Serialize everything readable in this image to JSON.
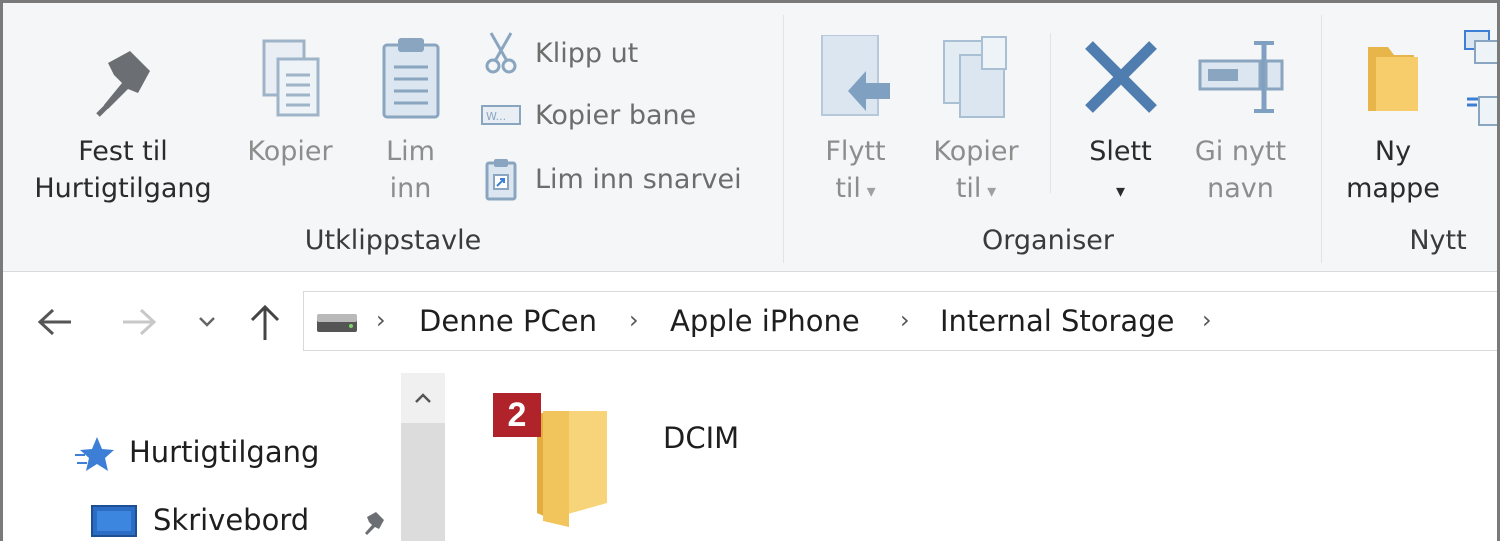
{
  "ribbon": {
    "clipboard": {
      "pin_label": "Fest til\nHurtigtilgang",
      "copy_label": "Kopier",
      "paste_label": "Lim\ninn",
      "cut_label": "Klipp ut",
      "copy_path_label": "Kopier bane",
      "paste_shortcut_label": "Lim inn snarvei",
      "group_label": "Utklippstavle"
    },
    "organize": {
      "move_label": "Flytt\ntil",
      "copyto_label": "Kopier\ntil",
      "delete_label": "Slett",
      "rename_label": "Gi nytt\nnavn",
      "group_label": "Organiser"
    },
    "new": {
      "new_folder_label": "Ny\nmappe",
      "group_label": "Nytt"
    }
  },
  "address": {
    "crumbs": [
      "Denne PCen",
      "Apple iPhone",
      "Internal Storage"
    ]
  },
  "nav": {
    "quick_access": "Hurtigtilgang",
    "desktop": "Skrivebord"
  },
  "content": {
    "badge": "2",
    "folder_name": "DCIM"
  },
  "colors": {
    "ribbon_bg": "#f5f6f7",
    "badge_red": "#b0232a",
    "folder_yellow": "#f2c55c",
    "accent_blue": "#3d7fd6"
  },
  "icons": [
    "pin-icon",
    "copy-icon",
    "clipboard-icon",
    "scissors-icon",
    "copy-path-icon",
    "paste-shortcut-icon",
    "move-to-icon",
    "copy-to-icon",
    "delete-icon",
    "rename-icon",
    "new-folder-icon",
    "back-icon",
    "forward-icon",
    "recent-dropdown-icon",
    "up-icon",
    "drive-icon",
    "star-icon",
    "desktop-icon",
    "folder-icon"
  ]
}
